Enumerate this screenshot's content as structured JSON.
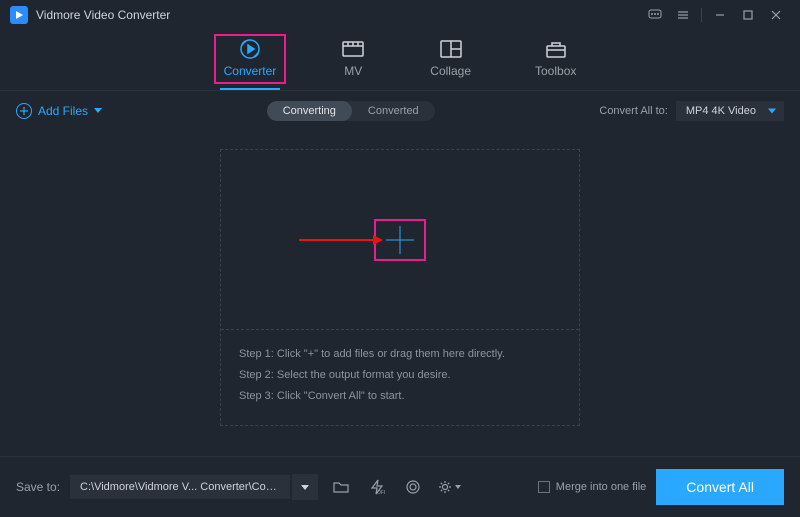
{
  "app": {
    "title": "Vidmore Video Converter"
  },
  "tabs": {
    "converter": "Converter",
    "mv": "MV",
    "collage": "Collage",
    "toolbox": "Toolbox"
  },
  "toolbar": {
    "add_files": "Add Files",
    "converting": "Converting",
    "converted": "Converted",
    "convert_all_to": "Convert All to:",
    "output_format": "MP4 4K Video"
  },
  "instructions": {
    "step1": "Step 1: Click \"+\" to add files or drag them here directly.",
    "step2": "Step 2: Select the output format you desire.",
    "step3": "Step 3: Click \"Convert All\" to start."
  },
  "footer": {
    "save_to_label": "Save to:",
    "save_path": "C:\\Vidmore\\Vidmore V... Converter\\Converted",
    "merge_label": "Merge into one file",
    "convert_all_btn": "Convert All"
  }
}
